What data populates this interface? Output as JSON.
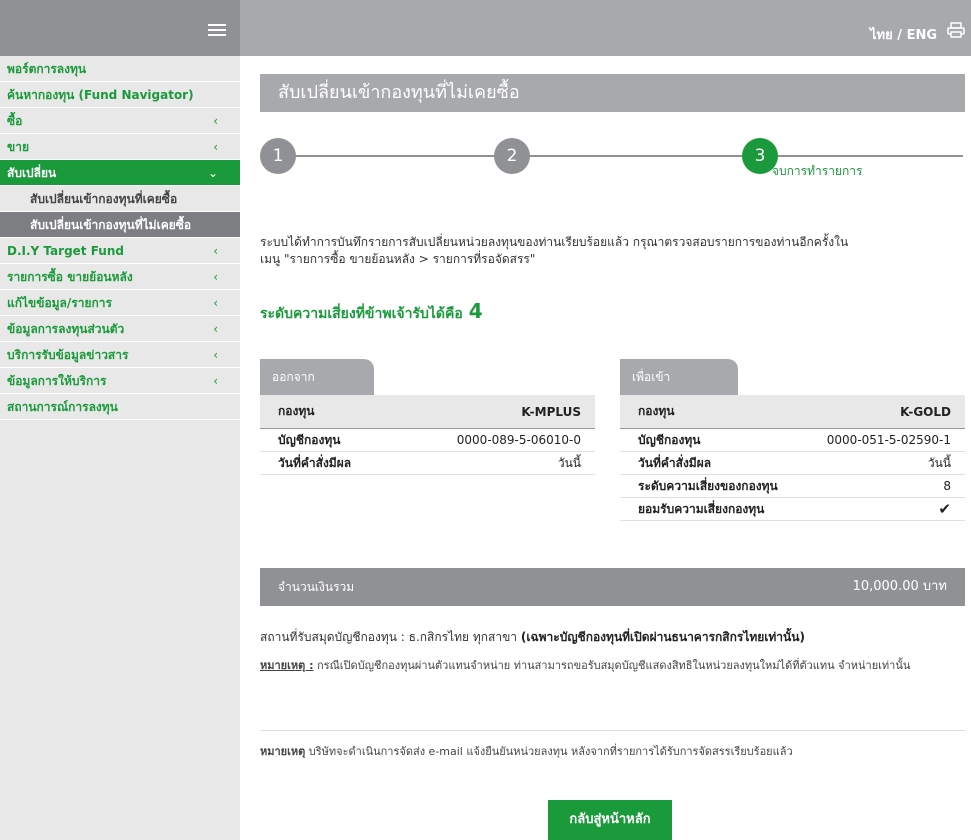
{
  "topbar": {
    "lang_thai": "ไทย",
    "lang_sep": " / ",
    "lang_eng": "ENG"
  },
  "icons": {
    "menu": "hamburger-icon",
    "print": "printer-icon",
    "chevron": "‹",
    "chevron_open": "⌄",
    "check": "✔"
  },
  "colors": {
    "brand_green": "#1a9a3b",
    "header_gray": "#a7a9ac",
    "dark_gray": "#8f9194"
  },
  "sidebar": {
    "items": [
      {
        "label": "พอร์ตการลงทุน",
        "chev": ""
      },
      {
        "label": "ค้นหากองทุน (Fund Navigator)",
        "chev": ""
      },
      {
        "label": "ซื้อ",
        "chev": "‹"
      },
      {
        "label": "ขาย",
        "chev": "‹"
      },
      {
        "label": "สับเปลี่ยน",
        "chev": "⌄"
      },
      {
        "label": "D.I.Y Target Fund",
        "chev": "‹"
      },
      {
        "label": "รายการซื้อ ขายย้อนหลัง",
        "chev": "‹"
      },
      {
        "label": "แก้ไขข้อมูล/รายการ",
        "chev": "‹"
      },
      {
        "label": "ข้อมูลการลงทุนส่วนตัว",
        "chev": "‹"
      },
      {
        "label": "บริการรับข้อมูลข่าวสาร",
        "chev": "‹"
      },
      {
        "label": "ข้อมูลการให้บริการ",
        "chev": "‹"
      },
      {
        "label": "สถานการณ์การลงทุน",
        "chev": ""
      }
    ],
    "sub": [
      {
        "label": "สับเปลี่ยนเข้ากองทุนที่เคยซื้อ"
      },
      {
        "label": "สับเปลี่ยนเข้ากองทุนที่ไม่เคยซื้อ"
      }
    ]
  },
  "main": {
    "title": "สับเปลี่ยนเข้ากองทุนที่ไม่เคยซื้อ",
    "steps": [
      "1",
      "2",
      "3"
    ],
    "step3_label": "จบการทำรายการ",
    "message_line1": "ระบบได้ทำการบันทึกรายการสับเปลี่ยนหน่วยลงทุนของท่านเรียบร้อยแล้ว กรุณาตรวจสอบรายการของท่านอีกครั้งใน",
    "message_line2": "เมนู \"รายการซื้อ ขายย้อนหลัง > รายการที่รอจัดสรร\"",
    "risk_label": "ระดับความเสี่ยงที่ข้าพเจ้ารับได้คือ",
    "risk_value": "4",
    "from": {
      "tab": "ออกจาก",
      "fund_label": "กองทุน",
      "fund_value": "K-MPLUS",
      "rows": [
        {
          "k": "บัญชีกองทุน",
          "v": "0000-089-5-06010-0"
        },
        {
          "k": "วันที่คำสั่งมีผล",
          "v": "วันนี้"
        }
      ]
    },
    "to": {
      "tab": "เพื่อเข้า",
      "fund_label": "กองทุน",
      "fund_value": "K-GOLD",
      "rows": [
        {
          "k": "บัญชีกองทุน",
          "v": "0000-051-5-02590-1"
        },
        {
          "k": "วันที่คำสั่งมีผล",
          "v": "วันนี้"
        },
        {
          "k": "ระดับความเสี่ยงของกองทุน",
          "v": "8"
        },
        {
          "k": "ยอมรับความเสี่ยงกองทุน",
          "v": "✔"
        }
      ]
    },
    "total_label": "จำนวนเงินรวม",
    "total_value": "10,000.00 บาท",
    "pickup_prefix": "สถานที่รับสมุดบัญชีกองทุน : ธ.กสิกรไทย ทุกสาขา ",
    "pickup_bold": "(เฉพาะบัญชีกองทุนที่เปิดผ่านธนาคารกสิกรไทยเท่านั้น)",
    "note1_label": "หมายเหตุ :",
    "note1_text": " กรณีเปิดบัญชีกองทุนผ่านตัวแทนจำหน่าย ท่านสามารถขอรับสมุดบัญชีแสดงสิทธิในหน่วยลงทุนใหม่ได้ที่ตัวแทน จำหน่ายเท่านั้น",
    "note2_label": "หมายเหตุ",
    "note2_text": "  บริษัทจะดำเนินการจัดส่ง e-mail แจ้งยืนยันหน่วยลงทุน หลังจากที่รายการได้รับการจัดสรรเรียบร้อยแล้ว",
    "back_button": "กลับสู่หน้าหลัก"
  }
}
